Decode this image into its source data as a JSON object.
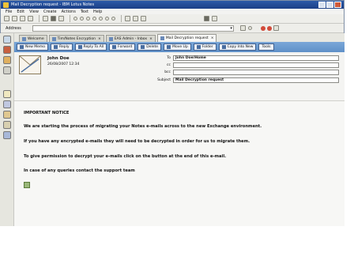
{
  "window": {
    "title": "Mail Decryption request - IBM Lotus Notes",
    "menu": [
      "File",
      "Edit",
      "View",
      "Create",
      "Actions",
      "Text",
      "Help"
    ]
  },
  "addressbar": {
    "label": "Address"
  },
  "tabs": [
    {
      "label": "Welcome"
    },
    {
      "label": "Tim/Notes Encryption"
    },
    {
      "label": "EAS Admin - Inbox"
    },
    {
      "label": "Mail Decryption request"
    }
  ],
  "actions": [
    "New Memo",
    "Reply",
    "Reply To All",
    "Forward",
    "Delete",
    "Move Up",
    "Folder",
    "Copy Into New",
    "Tools"
  ],
  "message": {
    "sender": "John Doe",
    "datetime": "26/08/2007 12:34",
    "to_label": "To",
    "to": "John Doe/Home",
    "cc_label": "cc",
    "cc": "",
    "bcc_label": "bcc",
    "bcc": "",
    "subject_label": "Subject",
    "subject": "Mail Decryption request",
    "body": [
      "IMPORTANT NOTICE",
      "We are starting the process of migrating your Notes e-mails across to the new Exchange environment.",
      "If you have any encrypted e-mails they will need to be decrypted in order for us to migrate them.",
      "To give permission to decrypt your e-mails click on the button at the end of this e-mail.",
      "In case of any queries contact the support team"
    ]
  }
}
